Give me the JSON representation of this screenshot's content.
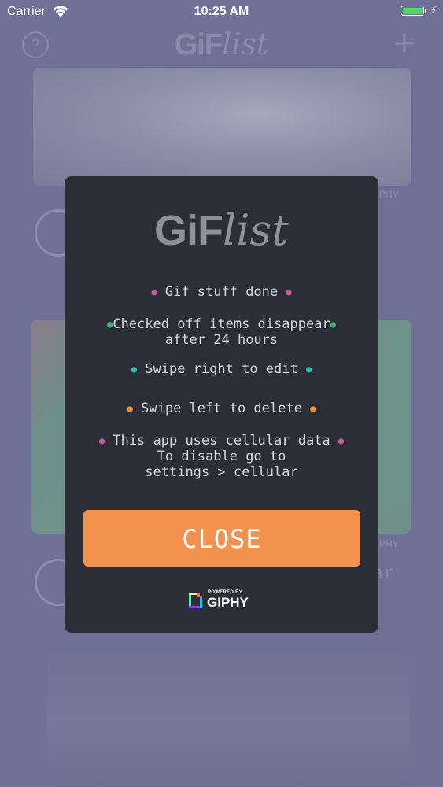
{
  "status_bar": {
    "carrier": "Carrier",
    "time": "10:25 AM",
    "battery_level": 1.0,
    "battery_color": "#4cd964"
  },
  "nav": {
    "help_glyph": "?",
    "logo_part1": "GiF",
    "logo_part2": "list",
    "add_glyph": "+"
  },
  "background": {
    "giphy_tag_1": "PHY",
    "giphy_tag_2": "PHY",
    "item_text_fragment": "ar"
  },
  "modal": {
    "logo_part1": "GiF",
    "logo_part2": "list",
    "tips": [
      {
        "line1": "Gif stuff done",
        "line2": "",
        "line3": "",
        "dot_color": "#c45aa5"
      },
      {
        "line1": "Checked off items disappear",
        "line2": "after 24 hours",
        "line3": "",
        "dot_color": "#3fb56a"
      },
      {
        "line1": "Swipe right to edit",
        "line2": "",
        "line3": "",
        "dot_color": "#2fbfb0"
      },
      {
        "line1": "Swipe left to delete",
        "line2": "",
        "line3": "",
        "dot_color": "#e68a3c"
      },
      {
        "line1": "This app uses cellular data",
        "line2": "To disable go to",
        "line3": "settings > cellular",
        "dot_color": "#c45aa5"
      }
    ],
    "close_label": "CLOSE",
    "powered_by": "POWERED BY",
    "giphy": "GIPHY"
  },
  "colors": {
    "accent": "#f2924d",
    "modal_bg": "#2b2d37",
    "overlay": "#6f7095"
  }
}
